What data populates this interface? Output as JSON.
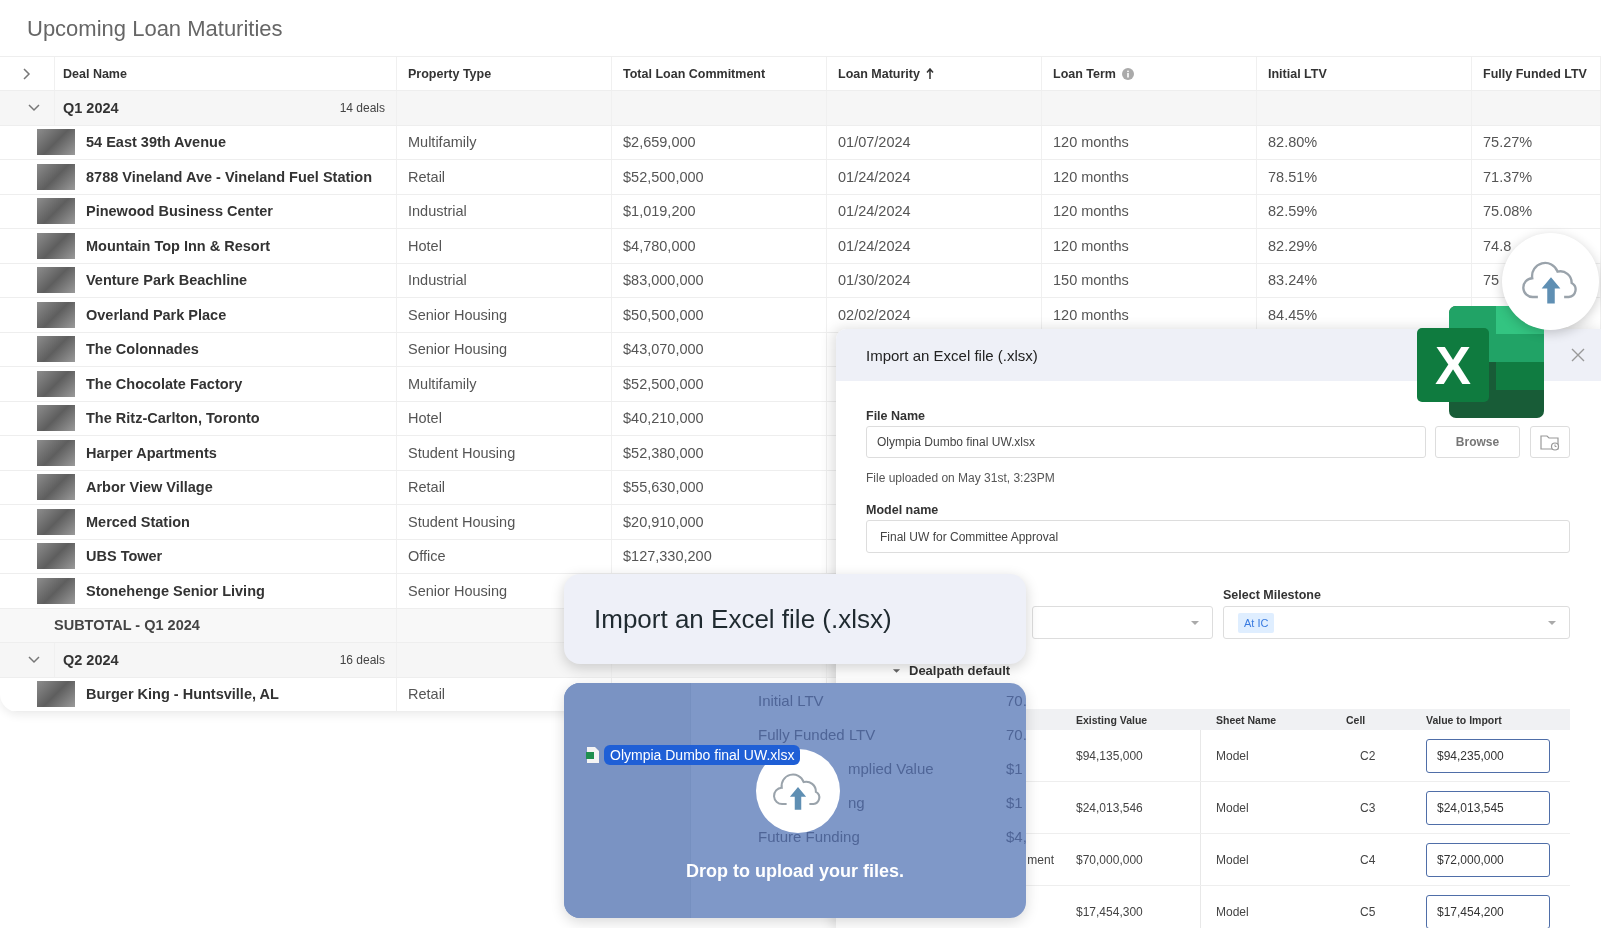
{
  "title": "Upcoming Loan Maturities",
  "table": {
    "expanded": false,
    "columns": [
      {
        "label": "Deal Name",
        "sorted": false,
        "info": false
      },
      {
        "label": "Property Type",
        "sorted": false,
        "info": false
      },
      {
        "label": "Total Loan Commitment",
        "sorted": false,
        "info": false
      },
      {
        "label": "Loan Maturity",
        "sorted": true,
        "info": false
      },
      {
        "label": "Loan Term",
        "sorted": false,
        "info": true
      },
      {
        "label": "Initial LTV",
        "sorted": false,
        "info": false
      },
      {
        "label": "Fully Funded LTV",
        "sorted": false,
        "info": false
      }
    ],
    "groups": [
      {
        "label": "Q1 2024",
        "count": "14 deals",
        "expanded": true,
        "subtotal": "SUBTOTAL - Q1 2024",
        "rows": [
          {
            "cells": [
              "54 East 39th Avenue",
              "Multifamily",
              "$2,659,000",
              "01/07/2024",
              "120 months",
              "82.80%",
              "75.27%"
            ]
          },
          {
            "cells": [
              "8788 Vineland Ave - Vineland Fuel Station",
              "Retail",
              "$52,500,000",
              "01/24/2024",
              "120 months",
              "78.51%",
              "71.37%"
            ]
          },
          {
            "cells": [
              "Pinewood Business Center",
              "Industrial",
              "$1,019,200",
              "01/24/2024",
              "120 months",
              "82.59%",
              "75.08%"
            ]
          },
          {
            "cells": [
              "Mountain Top Inn & Resort",
              "Hotel",
              "$4,780,000",
              "01/24/2024",
              "120 months",
              "82.29%",
              "74.8"
            ]
          },
          {
            "cells": [
              "Venture Park Beachline",
              "Industrial",
              "$83,000,000",
              "01/30/2024",
              "150 months",
              "83.24%",
              "75"
            ]
          },
          {
            "cells": [
              "Overland Park Place",
              "Senior Housing",
              "$50,500,000",
              "02/02/2024",
              "120 months",
              "84.45%"
            ]
          },
          {
            "cells": [
              "The Colonnades",
              "Senior Housing",
              "$43,070,000"
            ]
          },
          {
            "cells": [
              "The Chocolate Factory",
              "Multifamily",
              "$52,500,000"
            ]
          },
          {
            "cells": [
              "The Ritz-Carlton, Toronto",
              "Hotel",
              "$40,210,000"
            ]
          },
          {
            "cells": [
              "Harper Apartments",
              "Student Housing",
              "$52,380,000"
            ]
          },
          {
            "cells": [
              "Arbor View Village",
              "Retail",
              "$55,630,000"
            ]
          },
          {
            "cells": [
              "Merced Station",
              "Student Housing",
              "$20,910,000"
            ]
          },
          {
            "cells": [
              "UBS Tower",
              "Office",
              "$127,330,200"
            ]
          },
          {
            "cells": [
              "Stonehenge Senior Living",
              "Senior Housing"
            ]
          }
        ]
      },
      {
        "label": "Q2 2024",
        "count": "16 deals",
        "expanded": true,
        "rows": [
          {
            "cells": [
              "Burger King - Huntsville, AL",
              "Retail"
            ]
          }
        ]
      }
    ]
  },
  "dialog": {
    "title": "Import an Excel file (.xlsx)",
    "file_name_label": "File Name",
    "file_name_value": "Olympia Dumbo final UW.xlsx",
    "browse_label": "Browse",
    "upload_note": "File uploaded on May 31st, 3:23PM",
    "model_name_label": "Model name",
    "model_name_value": "Final UW for Committee Approval",
    "milestone_label": "Select Milestone",
    "milestone_tag": "At IC",
    "section_label": "Dealpath default",
    "section_expanded": true,
    "mapping": {
      "columns": [
        "Existing Value",
        "Sheet Name",
        "Cell",
        "Value to Import"
      ],
      "rows": [
        {
          "existing": "$94,135,000",
          "sheet": "Model",
          "cell": "C2",
          "value": "$94,235,000"
        },
        {
          "existing": "$24,013,546",
          "sheet": "Model",
          "cell": "C3",
          "value": "$24,013,545"
        },
        {
          "field": "ment",
          "existing": "$70,000,000",
          "sheet": "Model",
          "cell": "C4",
          "value": "$72,000,000"
        },
        {
          "existing": "$17,454,300",
          "sheet": "Model",
          "cell": "C5",
          "value": "$17,454,200"
        }
      ]
    }
  },
  "excel_logo": {
    "letter": "X"
  },
  "callout": {
    "title": "Import an Excel file (.xlsx)"
  },
  "drop_zone": {
    "behind_rows": [
      {
        "kind": "full",
        "label": "Initial LTV",
        "value": "70."
      },
      {
        "kind": "full",
        "label": "Fully Funded LTV",
        "value": "70."
      },
      {
        "kind": "partial",
        "label": "mplied Value",
        "value": "$1"
      },
      {
        "kind": "partial",
        "label": "ng",
        "value": "$1"
      },
      {
        "kind": "full",
        "label": "Future Funding",
        "value": "$4,"
      }
    ],
    "file_name": "Olympia Dumbo final UW.xlsx",
    "message": "Drop to upload your files."
  }
}
